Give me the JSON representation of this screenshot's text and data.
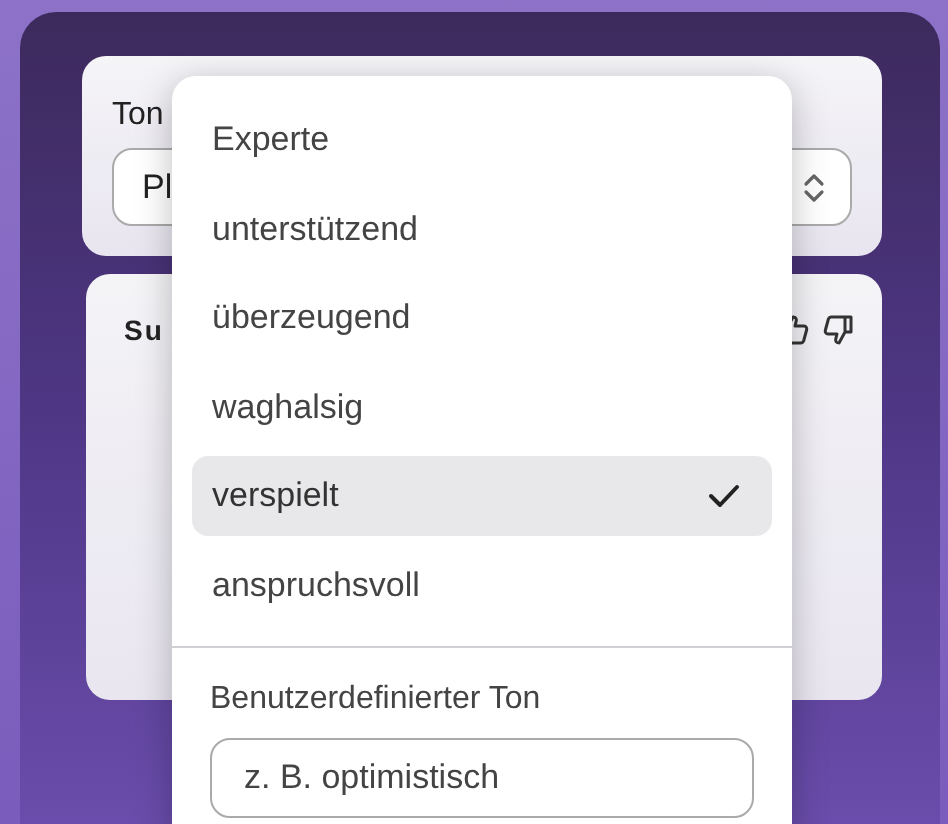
{
  "tone_card": {
    "label": "Ton",
    "select_value": "Pl"
  },
  "suggestion_card": {
    "title": "Su"
  },
  "dropdown": {
    "options": [
      {
        "label": "Experte",
        "selected": false
      },
      {
        "label": "unterstützend",
        "selected": false
      },
      {
        "label": "überzeugend",
        "selected": false
      },
      {
        "label": "waghalsig",
        "selected": false
      },
      {
        "label": "verspielt",
        "selected": true
      },
      {
        "label": "anspruchsvoll",
        "selected": false
      }
    ],
    "custom": {
      "label": "Benutzerdefinierter Ton",
      "placeholder": "z. B. optimistisch"
    }
  }
}
